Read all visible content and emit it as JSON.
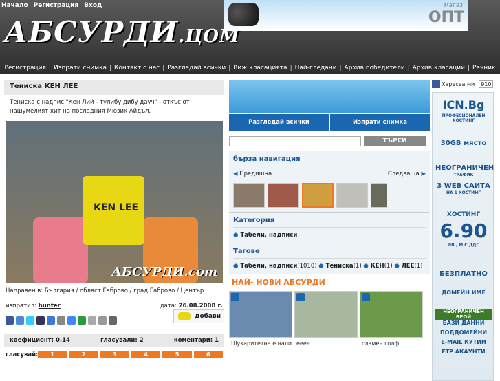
{
  "topnav": [
    "Начало",
    "Регистрация",
    "Вход"
  ],
  "logo": {
    "main": "АБСУРДИ",
    "tld": ".ЦОМ"
  },
  "banner": {
    "shop_top": "магаз",
    "shop_big": "ОПТ"
  },
  "mainnav": [
    "Регистрация",
    "Изпрати снимка",
    "Контакт с нас",
    "Разгледай всички",
    "Виж класацията",
    "Най-гледани",
    "Архив победители",
    "Архив класации",
    "Речник"
  ],
  "post": {
    "title": "Тениска КЕН ЛЕЕ",
    "description": "Тениска с надпис \"Кен Лий - тулибу дибу дауч\" - откъс от нашумелият хит на последния Мюзик Айдъл.",
    "photo_text": "KEN LEE",
    "watermark": "АБСУРДИ.com",
    "made_in": "Направен в: България / област Габрово / град Габрово / Център",
    "sent_by_label": "изпратил:",
    "sent_by": "hunter",
    "date_label": "дата:",
    "date": "26.08.2008 г.",
    "add_label": "добави",
    "coef": "коефициент: 0.14",
    "voted": "гласували: 2",
    "comments": "коментари: 1",
    "vote_label": "гласувай:",
    "vote_options": [
      "1",
      "2",
      "3",
      "4",
      "5",
      "6"
    ]
  },
  "mid": {
    "browse_all": "Разгледай всички",
    "send_photo": "Изпрати снимка",
    "search_placeholder": "",
    "search_btn": "ТЪРСИ",
    "quick_nav_title": "бърза навигация",
    "prev": "Предишна",
    "next": "Следваща",
    "category_title": "Категория",
    "category": "Табели, надписи",
    "tags_title": "Тагове",
    "tags": [
      {
        "name": "Табели, надписи",
        "count": "(1010)"
      },
      {
        "name": "Тениска",
        "count": "(1)"
      },
      {
        "name": "КЕН",
        "count": "(1)"
      },
      {
        "name": "ЛЕЕ",
        "count": "(1)"
      }
    ],
    "newest_title": "НАЙ- НОВИ АБСУРДИ",
    "newest": [
      "Шукаритетна е нали",
      "ееее",
      "сламен голф"
    ]
  },
  "right": {
    "like": "Харесва ми",
    "like_count": "910",
    "ad": [
      "ICN.Bg",
      "ПРОФЕСИОНАЛЕН ХОСТИНГ",
      "30GB място",
      "НЕОГРАНИЧЕН",
      "ТРАФИК",
      "3 WEB САЙТА",
      "НА 1 ХОСТИНГ",
      "ХОСТИНГ",
      "6.90",
      "ЛВ./ М С ДДС",
      "БЕЗПЛАТНО",
      "ДОМЕЙН ИМЕ",
      "НЕОГРАНИЧЕН БРОЙ",
      "БАЗИ ДАННИ",
      "ПОДДОМЕЙНИ",
      "E-MAIL КУТИИ",
      "FTP АКАУНТИ"
    ]
  },
  "colors": {
    "accent": "#f07820",
    "blue": "#1a66b0"
  }
}
